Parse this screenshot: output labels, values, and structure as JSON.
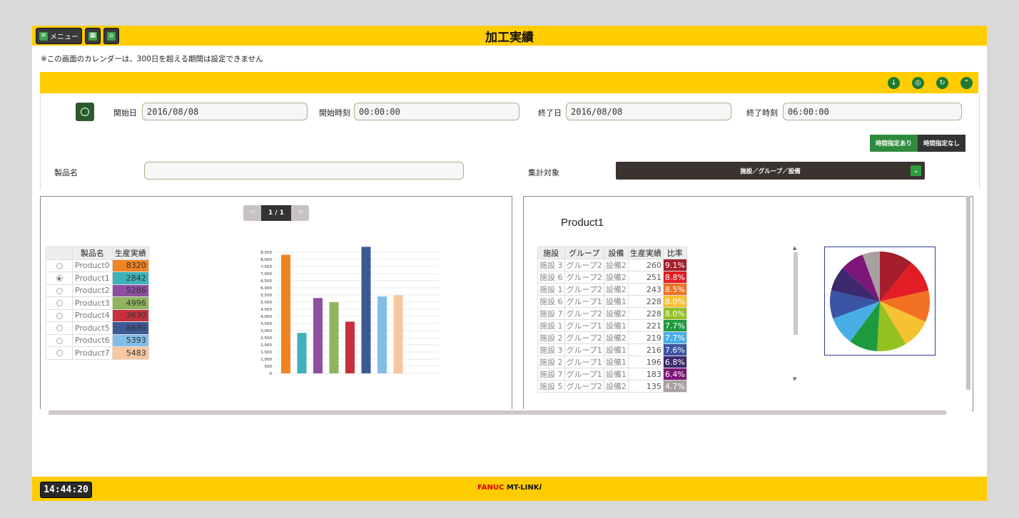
{
  "header": {
    "menu_label": "メニュー",
    "title": "加工実績"
  },
  "notice": "※この画面のカレンダーは、300日を超える期間は設定できません",
  "filter": {
    "start_date_label": "開始日",
    "start_date_value": "2016/08/08",
    "start_time_label": "開始時刻",
    "start_time_value": "00:00:00",
    "end_date_label": "終了日",
    "end_date_value": "2016/08/08",
    "end_time_label": "終了時刻",
    "end_time_value": "06:00:00",
    "toggle_on": "時間指定あり",
    "toggle_off": "時間指定なし",
    "product_label": "製品名",
    "product_value": "",
    "target_label": "集計対象",
    "target_value": "施設／グループ／設備"
  },
  "pager": {
    "text": "1 / 1",
    "prev": "<",
    "next": ">"
  },
  "product_table": {
    "headers": [
      "製品名",
      "生産実績"
    ],
    "rows": [
      {
        "name": "Product0",
        "value": "8320",
        "color": "#f08322"
      },
      {
        "name": "Product1",
        "value": "2842",
        "color": "#3fb1b8"
      },
      {
        "name": "Product2",
        "value": "5286",
        "color": "#8f4ea0"
      },
      {
        "name": "Product3",
        "value": "4996",
        "color": "#8fb55d"
      },
      {
        "name": "Product4",
        "value": "3630",
        "color": "#c6303d"
      },
      {
        "name": "Product5",
        "value": "8880",
        "color": "#3e5994"
      },
      {
        "name": "Product6",
        "value": "5393",
        "color": "#82bde8"
      },
      {
        "name": "Product7",
        "value": "5483",
        "color": "#f6c7a0"
      }
    ],
    "selected_index": 1
  },
  "chart_data": [
    {
      "type": "bar",
      "categories": [
        "Product0",
        "Product1",
        "Product2",
        "Product3",
        "Product4",
        "Product5",
        "Product6",
        "Product7"
      ],
      "values": [
        8320,
        2842,
        5286,
        4996,
        3630,
        8880,
        5393,
        5483
      ],
      "colors": [
        "#f08322",
        "#3fb1b8",
        "#8f4ea0",
        "#8fb55d",
        "#c6303d",
        "#3e5994",
        "#82bde8",
        "#f6c7a0"
      ],
      "yticks": [
        "0",
        "500",
        "1,000",
        "1,500",
        "2,000",
        "2,500",
        "3,000",
        "3,500",
        "4,000",
        "4,500",
        "5,000",
        "5,500",
        "6,000",
        "6,500",
        "7,000",
        "7,500",
        "8,000",
        "8,500"
      ],
      "ylim": [
        0,
        8500
      ],
      "grid": true
    },
    {
      "type": "pie",
      "title": "Product1",
      "labels": [
        "施設3 グループ2 設備2",
        "施設6 グループ2 設備2",
        "施設1 グループ2 設備2",
        "施設6 グループ1 設備1",
        "施設7 グループ2 設備2",
        "施設1 グループ1 設備1",
        "施設2 グループ2 設備2",
        "施設3 グループ1 設備1",
        "施設2 グループ1 設備1",
        "施設7 グループ1 設備1",
        "施設5 グループ2 設備2"
      ],
      "values": [
        9.1,
        8.8,
        8.5,
        8.0,
        8.0,
        7.7,
        7.7,
        7.6,
        6.8,
        6.4,
        4.7
      ],
      "colors": [
        "#a51e2b",
        "#e31d25",
        "#f27021",
        "#f6c232",
        "#94c120",
        "#1e9a3e",
        "#4aaee6",
        "#3b54a3",
        "#3d2a6e",
        "#7e1679",
        "#a8a0a1"
      ]
    }
  ],
  "detail": {
    "title": "Product1",
    "headers": [
      "施設",
      "グループ",
      "設備",
      "生産実績",
      "比率"
    ],
    "rows": [
      {
        "facility": "施設 3",
        "group": "グループ2",
        "equip": "設備2",
        "value": "260",
        "pct": "9.1%",
        "color": "#a51e2b"
      },
      {
        "facility": "施設 6",
        "group": "グループ2",
        "equip": "設備2",
        "value": "251",
        "pct": "8.8%",
        "color": "#e31d25"
      },
      {
        "facility": "施設 1",
        "group": "グループ2",
        "equip": "設備2",
        "value": "243",
        "pct": "8.5%",
        "color": "#f27021"
      },
      {
        "facility": "施設 6",
        "group": "グループ1",
        "equip": "設備1",
        "value": "228",
        "pct": "8.0%",
        "color": "#f6c232"
      },
      {
        "facility": "施設 7",
        "group": "グループ2",
        "equip": "設備2",
        "value": "228",
        "pct": "8.0%",
        "color": "#94c120"
      },
      {
        "facility": "施設 1",
        "group": "グループ1",
        "equip": "設備1",
        "value": "221",
        "pct": "7.7%",
        "color": "#1e9a3e"
      },
      {
        "facility": "施設 2",
        "group": "グループ2",
        "equip": "設備2",
        "value": "219",
        "pct": "7.7%",
        "color": "#4aaee6"
      },
      {
        "facility": "施設 3",
        "group": "グループ1",
        "equip": "設備1",
        "value": "216",
        "pct": "7.6%",
        "color": "#3b54a3"
      },
      {
        "facility": "施設 2",
        "group": "グループ1",
        "equip": "設備1",
        "value": "196",
        "pct": "6.8%",
        "color": "#3d2a6e"
      },
      {
        "facility": "施設 7",
        "group": "グループ1",
        "equip": "設備1",
        "value": "183",
        "pct": "6.4%",
        "color": "#7e1679"
      },
      {
        "facility": "施設 5",
        "group": "グループ2",
        "equip": "設備2",
        "value": "135",
        "pct": "4.7%",
        "color": "#a8a0a1"
      }
    ]
  },
  "footer": {
    "clock": "14:44:20",
    "brand_fanuc": "FANUC",
    "brand_mt": "MT-LINK",
    "brand_i": "i"
  },
  "colors": {
    "accent_yellow": "#ffcc00",
    "button_green": "#1f7a32",
    "dark": "#333333"
  }
}
